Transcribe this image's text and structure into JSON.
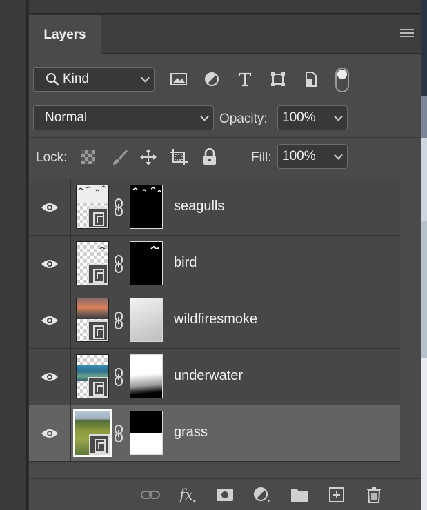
{
  "panel": {
    "tab_label": "Layers"
  },
  "filter": {
    "kind_label": "Kind",
    "icons": [
      "image-filter-icon",
      "adjustment-filter-icon",
      "type-filter-icon",
      "shape-filter-icon",
      "smart-object-filter-icon",
      "filter-toggle-icon"
    ]
  },
  "blend": {
    "mode": "Normal",
    "opacity_label": "Opacity:",
    "opacity_value": "100%"
  },
  "lock": {
    "label": "Lock:",
    "icons": [
      "lock-transparent-pixels-icon",
      "lock-image-pixels-icon",
      "lock-position-icon",
      "lock-artboard-icon",
      "lock-all-icon"
    ],
    "fill_label": "Fill:",
    "fill_value": "100%"
  },
  "layers": [
    {
      "name": "seagulls",
      "visible": true,
      "selected": false,
      "thumbnail": "seagulls-thumb",
      "mask": "black-with-white-birds"
    },
    {
      "name": "bird",
      "visible": true,
      "selected": false,
      "thumbnail": "bird-thumb",
      "mask": "black-with-white-bird"
    },
    {
      "name": "wildfiresmoke",
      "visible": true,
      "selected": false,
      "thumbnail": "smoke-thumb",
      "mask": "light-gray-gradient"
    },
    {
      "name": "underwater",
      "visible": true,
      "selected": false,
      "thumbnail": "underwater-thumb",
      "mask": "white-to-black-gradient"
    },
    {
      "name": "grass",
      "visible": true,
      "selected": true,
      "thumbnail": "grass-thumb",
      "mask": "black-top-white-bottom"
    }
  ],
  "bottom_icons": [
    "link-layers-icon",
    "fx-icon",
    "add-mask-icon",
    "adjustment-layer-icon",
    "new-group-icon",
    "new-layer-icon",
    "delete-layer-icon"
  ],
  "bottom": {
    "fx_label": "fx"
  },
  "colors": {
    "panel_bg": "#4a4a4a",
    "selected_layer": "#636363",
    "control_bg": "#383838"
  }
}
